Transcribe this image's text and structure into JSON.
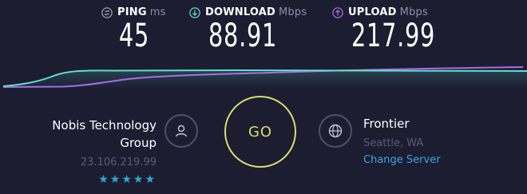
{
  "metrics": {
    "ping": {
      "label": "PING",
      "unit": "ms",
      "value": "45"
    },
    "download": {
      "label": "DOWNLOAD",
      "unit": "Mbps",
      "value": "88.91"
    },
    "upload": {
      "label": "UPLOAD",
      "unit": "Mbps",
      "value": "217.99"
    }
  },
  "host": {
    "name_line1": "Nobis Technology",
    "name_line2": "Group",
    "ip": "23.106.219.99",
    "stars": "★★★★★",
    "rating": 5
  },
  "go_button": {
    "label": "GO"
  },
  "isp": {
    "name": "Frontier",
    "location": "Seattle, WA",
    "change_server_label": "Change Server"
  },
  "colors": {
    "background": "#1c1d31",
    "ping_icon": "#9fa1b5",
    "download": "#5fe0d0",
    "upload": "#a96ce6",
    "go": "#d8dd6b",
    "link": "#3fa4e4",
    "stars": "#2aa9d6"
  },
  "icons": {
    "ping": "ping-icon",
    "download": "download-arrow-icon",
    "upload": "upload-arrow-icon",
    "host": "user-icon",
    "isp": "globe-icon"
  }
}
